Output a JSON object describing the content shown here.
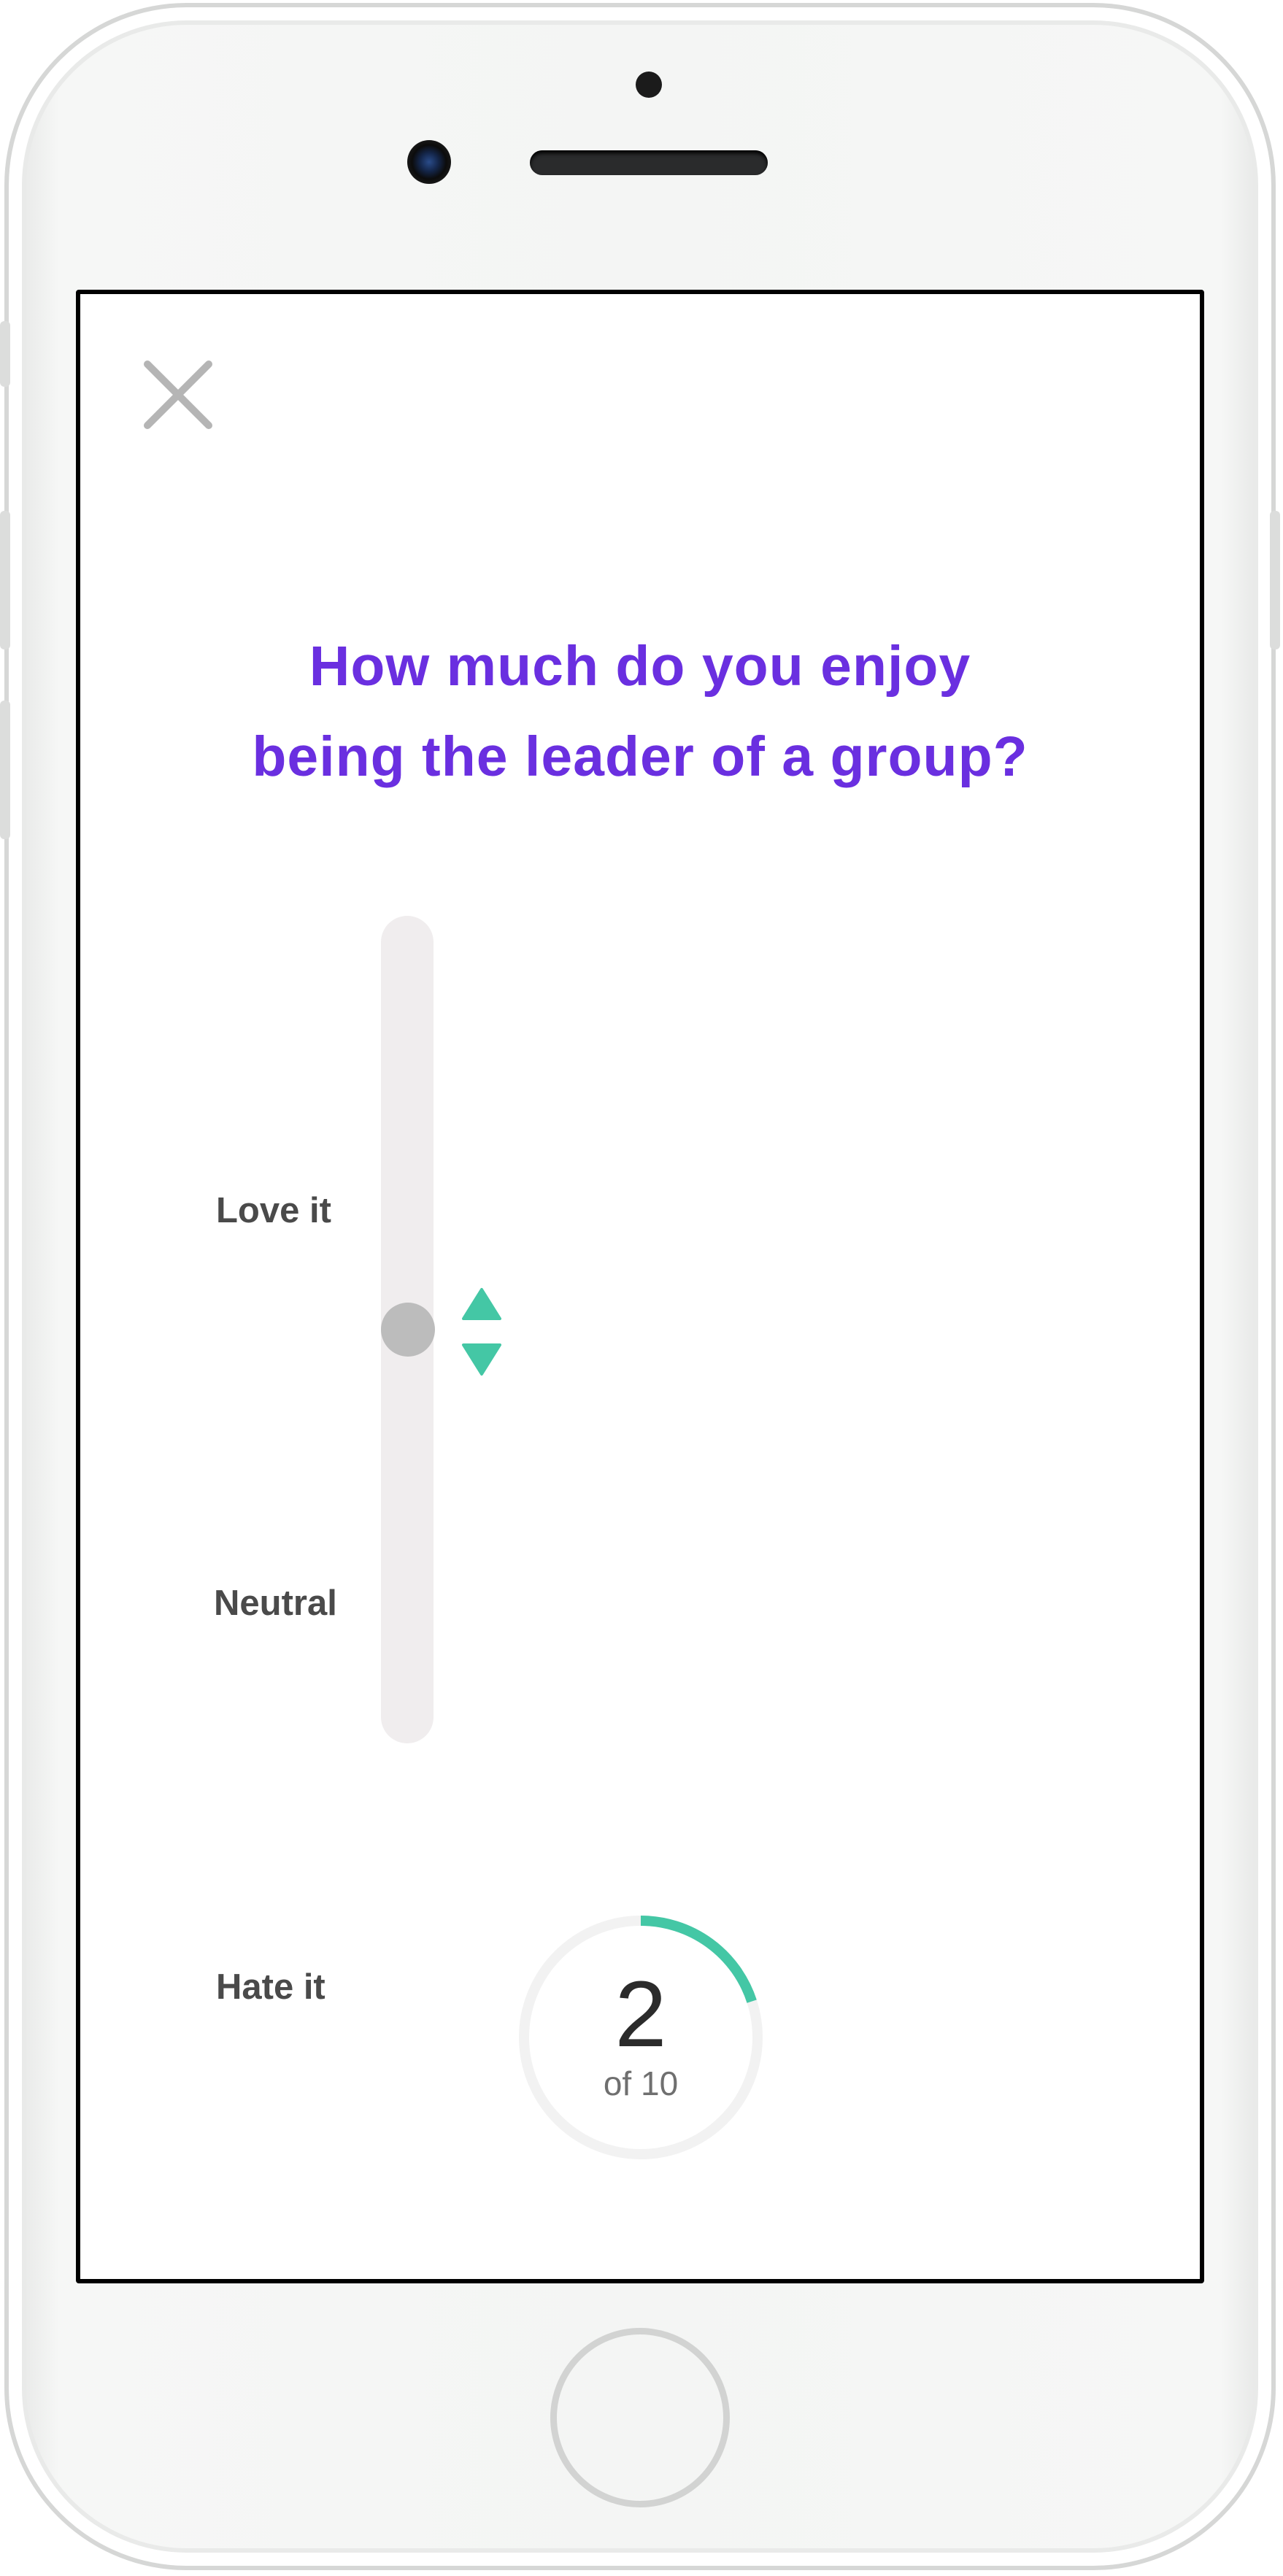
{
  "question": {
    "line1": "How much do you enjoy",
    "line2": "being the leader of a group?"
  },
  "slider": {
    "label_top": "Love it",
    "label_middle": "Neutral",
    "label_bottom": "Hate it",
    "value_fraction": 0.5
  },
  "progress": {
    "current": "2",
    "total_text": "of 10",
    "fraction": 0.2
  },
  "icons": {
    "close": "close-icon",
    "increase": "triangle-up-icon",
    "decrease": "triangle-down-icon"
  },
  "colors": {
    "accent_purple": "#6a2fe0",
    "accent_teal": "#44c7a5",
    "thumb_gray": "#bcbcbc",
    "track_gray": "#f0edee",
    "ring_gray": "#f2f2f2",
    "label_gray": "#4a4a4a"
  }
}
